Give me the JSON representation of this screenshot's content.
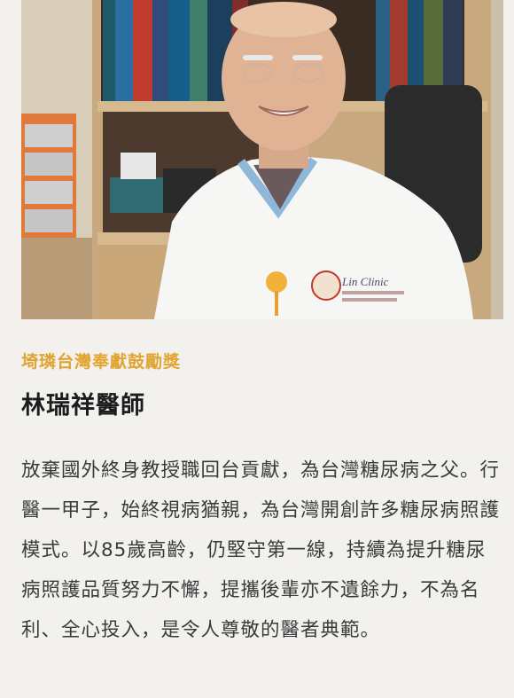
{
  "card": {
    "award_title": "埼璘台灣奉獻鼓勵獎",
    "person_name": "林瑞祥醫師",
    "description": "放棄國外終身教授職回台貢獻，為台灣糖尿病之父。行醫一甲子，始終視病猶親，為台灣開創許多糖尿病照護模式。以85歲高齡，仍堅守第一線，持續為提升糖尿病照護品質努力不懈，提攜後輩亦不遺餘力，不為名利、全心投入，是令人尊敬的醫者典範。",
    "photo": {
      "shirt_logo": "Lin Clinic"
    }
  },
  "colors": {
    "award": "#e2a431",
    "name": "#1c1c1c",
    "body_text": "#3a3a3a",
    "background": "#f2f1ee"
  }
}
